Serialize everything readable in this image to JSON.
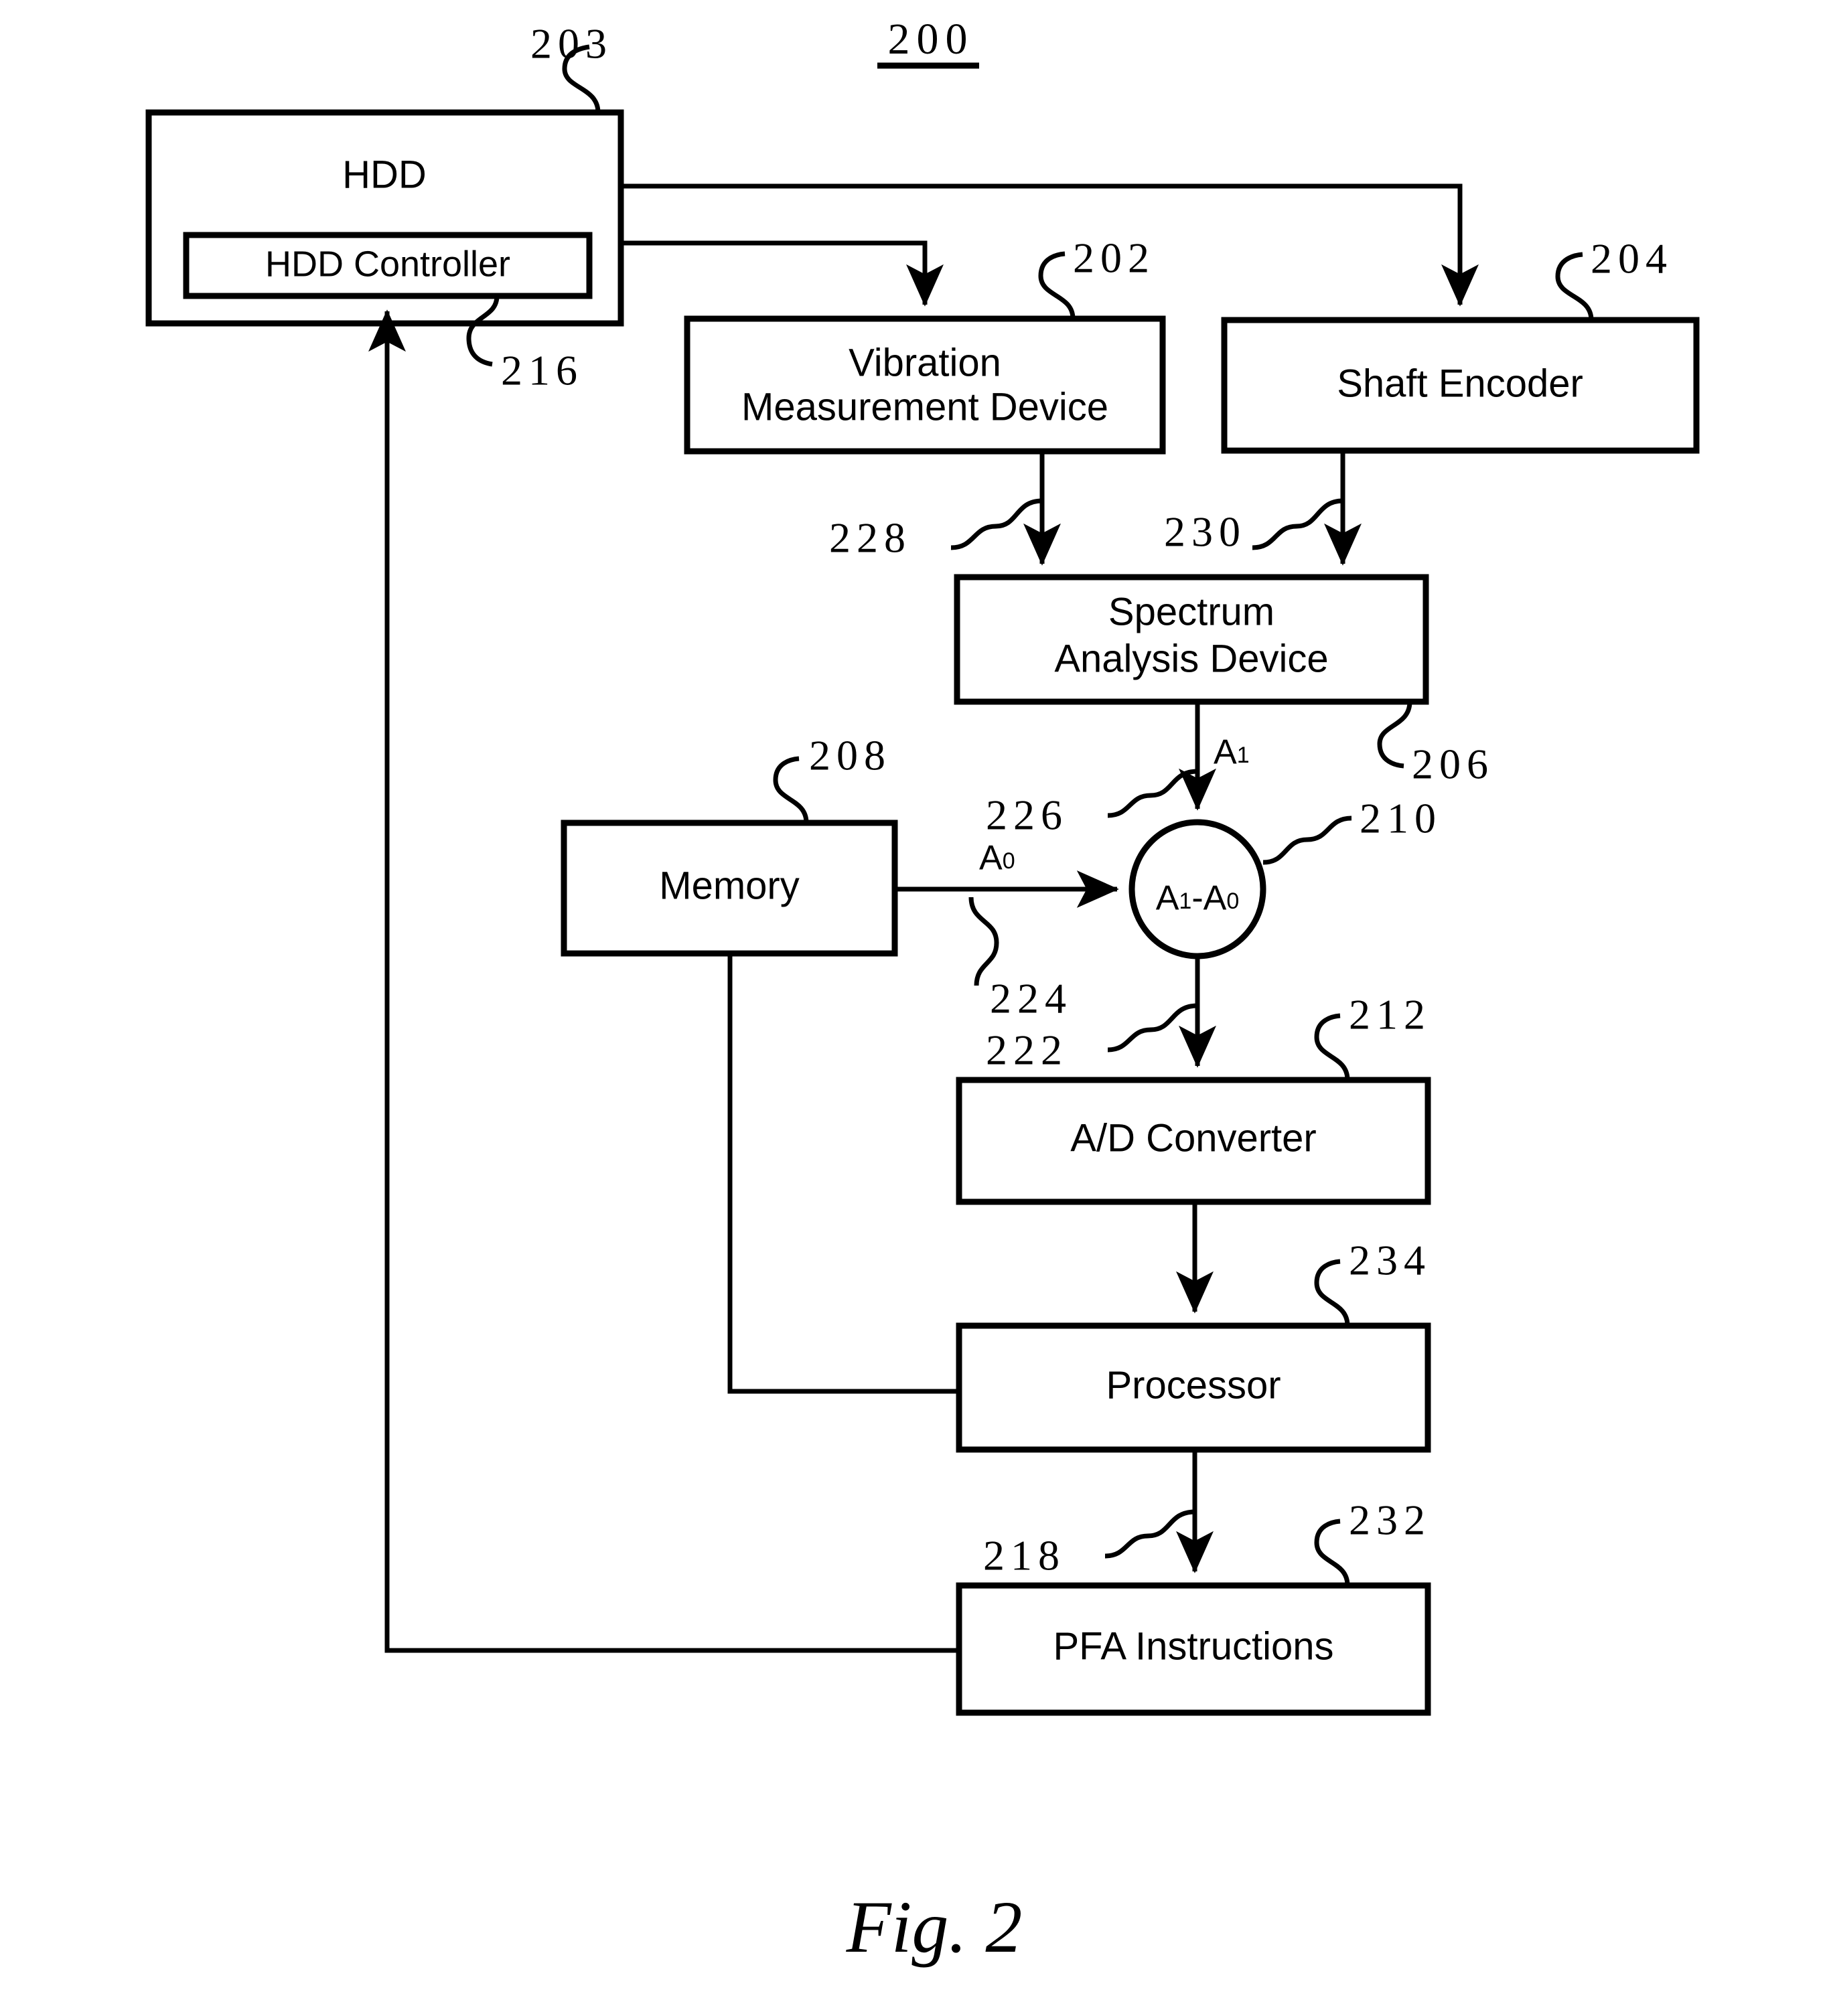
{
  "figure": {
    "system_number": "200",
    "caption": "Fig. 2"
  },
  "boxes": {
    "hdd": {
      "label": "HDD",
      "ref": "203"
    },
    "hdd_controller": {
      "label": "HDD Controller",
      "ref": "216"
    },
    "vibration_device": {
      "label_line1": "Vibration",
      "label_line2": "Measurement Device",
      "ref": "202"
    },
    "shaft_encoder": {
      "label": "Shaft Encoder",
      "ref": "204"
    },
    "spectrum_device": {
      "label_line1": "Spectrum",
      "label_line2": "Analysis Device",
      "ref": "206"
    },
    "memory": {
      "label": "Memory",
      "ref": "208"
    },
    "summing_node": {
      "label_main": "A",
      "label_sub1": "1",
      "label_minus": "-A",
      "label_sub2": "0",
      "ref": "210"
    },
    "ad_converter": {
      "label": "A/D Converter",
      "ref": "212"
    },
    "processor": {
      "label": "Processor",
      "ref": "234"
    },
    "pfa_instructions": {
      "label": "PFA Instructions",
      "ref": "232"
    }
  },
  "connections": {
    "vib_to_spectrum": {
      "ref": "228"
    },
    "shaft_to_spectrum": {
      "ref": "230"
    },
    "spectrum_to_sum": {
      "ref": "226",
      "signal": "A",
      "signal_sub": "1"
    },
    "memory_to_sum": {
      "ref": "224",
      "signal": "A",
      "signal_sub": "0"
    },
    "sum_to_adc": {
      "ref": "222"
    },
    "processor_to_pfa": {
      "ref": "218"
    }
  }
}
